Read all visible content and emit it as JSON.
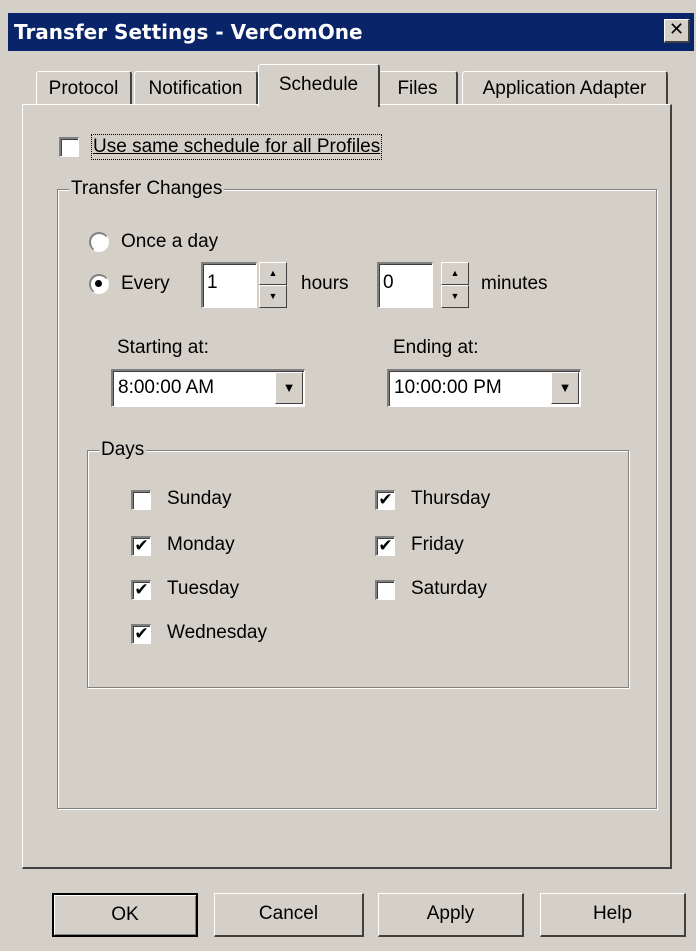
{
  "window": {
    "title": "Transfer Settings - VerComOne",
    "close_glyph": "✕"
  },
  "tabs": [
    {
      "label": "Protocol"
    },
    {
      "label": "Notification"
    },
    {
      "label": "Schedule",
      "active": true
    },
    {
      "label": "Files"
    },
    {
      "label": "Application Adapter"
    }
  ],
  "schedule": {
    "same_schedule_label": "Use same schedule for all Profiles",
    "same_schedule_checked": false,
    "transfer_changes": {
      "title": "Transfer Changes",
      "once_a_day_label": "Once a day",
      "every_label": "Every",
      "selected": "every",
      "hours_value": "1",
      "hours_label": "hours",
      "minutes_value": "0",
      "minutes_label": "minutes",
      "starting_label": "Starting at:",
      "starting_value": "8:00:00 AM",
      "ending_label": "Ending at:",
      "ending_value": "10:00:00 PM"
    },
    "days": {
      "title": "Days",
      "items": [
        {
          "label": "Sunday",
          "checked": false
        },
        {
          "label": "Monday",
          "checked": true
        },
        {
          "label": "Tuesday",
          "checked": true
        },
        {
          "label": "Wednesday",
          "checked": true
        },
        {
          "label": "Thursday",
          "checked": true
        },
        {
          "label": "Friday",
          "checked": true
        },
        {
          "label": "Saturday",
          "checked": false
        }
      ]
    }
  },
  "buttons": {
    "ok": "OK",
    "cancel": "Cancel",
    "apply": "Apply",
    "help": "Help"
  },
  "glyphs": {
    "check": "✔",
    "up": "▲",
    "down": "▼"
  },
  "colors": {
    "titlebar": "#0a246a",
    "face": "#d4d0c8"
  }
}
